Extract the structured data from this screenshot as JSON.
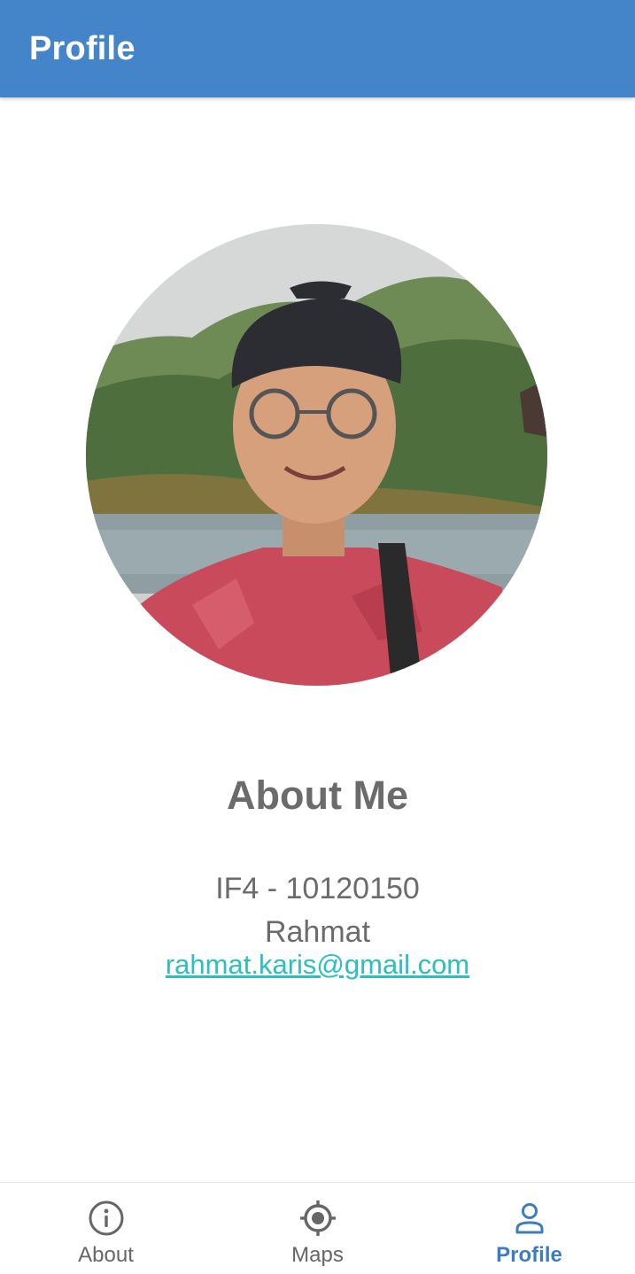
{
  "app_bar": {
    "title": "Profile",
    "color": "#4484c8"
  },
  "profile": {
    "heading": "About Me",
    "student_id": "IF4 - 10120150",
    "name": "Rahmat",
    "email": "rahmat.karis@gmail.com",
    "text_color": "#6b6b6b",
    "link_color": "#2bbfc0"
  },
  "bottom_nav": {
    "items": [
      {
        "label": "About",
        "icon": "info-icon",
        "active": false
      },
      {
        "label": "Maps",
        "icon": "location-target-icon",
        "active": false
      },
      {
        "label": "Profile",
        "icon": "person-icon",
        "active": true
      }
    ],
    "active_color": "#3e7cc2",
    "inactive_color": "#666666"
  }
}
